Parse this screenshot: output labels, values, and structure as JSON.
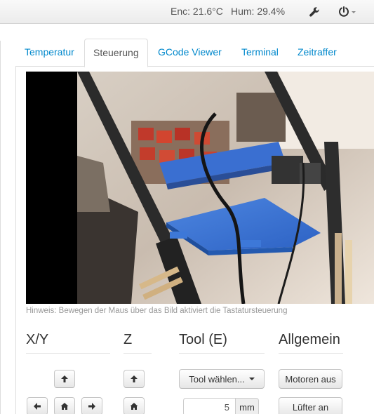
{
  "navbar": {
    "enclosure": "Enc: 21.6°C",
    "humidity": "Hum: 29.4%",
    "settings_icon": "wrench-icon",
    "power_icon": "power-icon"
  },
  "tabs": [
    {
      "label": "Temperatur",
      "active": false
    },
    {
      "label": "Steuerung",
      "active": true
    },
    {
      "label": "GCode Viewer",
      "active": false
    },
    {
      "label": "Terminal",
      "active": false
    },
    {
      "label": "Zeitraffer",
      "active": false
    }
  ],
  "webcam": {
    "hint": "Hinweis: Bewegen der Maus über das Bild aktiviert die Tastatursteuerung"
  },
  "controls": {
    "xy": {
      "title": "X/Y"
    },
    "z": {
      "title": "Z"
    },
    "tool": {
      "title": "Tool (E)",
      "select_label": "Tool wählen...",
      "amount_value": "5",
      "amount_unit": "mm"
    },
    "general": {
      "title": "Allgemein",
      "motors_off": "Motoren aus",
      "fan_on": "Lüfter an"
    }
  },
  "colors": {
    "link": "#0088cc",
    "accent_blue": "#2f6fd0"
  }
}
